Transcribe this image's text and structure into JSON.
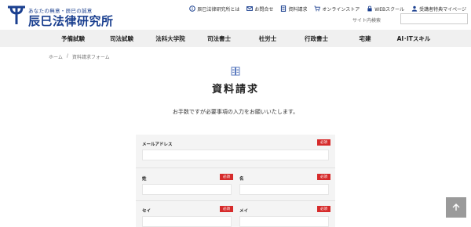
{
  "header": {
    "tagline": "あなたの無意・辰巳の誠意",
    "logo_name": "辰巳法律研究所",
    "topnav": [
      {
        "label": "辰巳法律研究所とは",
        "icon": "info-icon"
      },
      {
        "label": "お問合せ",
        "icon": "mail-icon"
      },
      {
        "label": "資料請求",
        "icon": "document-icon"
      },
      {
        "label": "オンラインストア",
        "icon": "cart-icon"
      },
      {
        "label": "WEBスクール",
        "icon": "lock-icon"
      },
      {
        "label": "受講者特典マイページ",
        "icon": "user-icon"
      }
    ],
    "search_label": "サイト内検索",
    "search_value": ""
  },
  "mainnav": [
    "予備試験",
    "司法試験",
    "法科大学院",
    "司法書士",
    "社労士",
    "行政書士",
    "宅建",
    "AI･ITスキル"
  ],
  "breadcrumb": {
    "home": "ホーム",
    "sep": "/",
    "current": "資料請求フォーム"
  },
  "page": {
    "title": "資料請求",
    "intro": "お手数ですが必要事項の入力をお願いいたします。"
  },
  "form": {
    "required_label": "必須",
    "email_label": "メールアドレス",
    "last_name_label": "姓",
    "first_name_label": "名",
    "last_kana_label": "セイ",
    "first_kana_label": "メイ"
  },
  "colors": {
    "brand": "#1a3f8f",
    "required": "#d62b2b",
    "nav_bg": "#f0f0f0"
  }
}
